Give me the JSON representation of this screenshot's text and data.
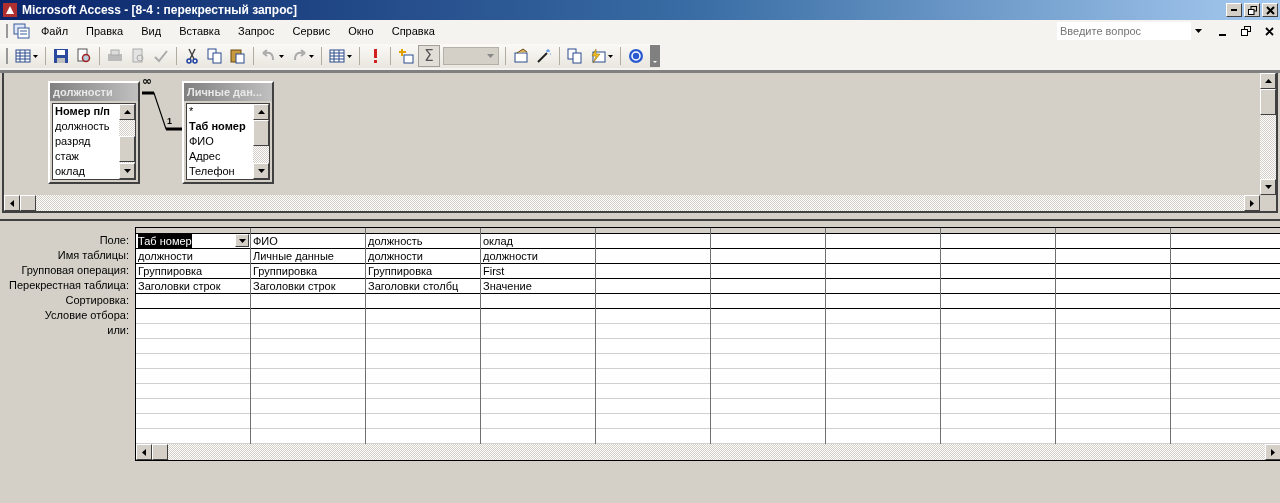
{
  "window": {
    "title": "Microsoft Access - [8-4 : перекрестный запрос]"
  },
  "menu": [
    "Файл",
    "Правка",
    "Вид",
    "Вставка",
    "Запрос",
    "Сервис",
    "Окно",
    "Справка"
  ],
  "help_search": {
    "placeholder": "Введите вопрос"
  },
  "toolbar": {
    "totals": {
      "label": "Σ",
      "on": true
    }
  },
  "tables": [
    {
      "name": "должности",
      "fields": [
        {
          "name": "Номер п/п",
          "key": true
        },
        {
          "name": "должность",
          "key": false
        },
        {
          "name": "разряд",
          "key": false
        },
        {
          "name": "стаж",
          "key": false
        },
        {
          "name": "оклад",
          "key": false
        }
      ]
    },
    {
      "name": "Личные дан...",
      "fields": [
        {
          "name": "*",
          "key": false
        },
        {
          "name": "Таб номер",
          "key": true
        },
        {
          "name": "ФИО",
          "key": false
        },
        {
          "name": "Адрес",
          "key": false
        },
        {
          "name": "Телефон",
          "key": false
        }
      ]
    }
  ],
  "relationship": {
    "many_label": "∞",
    "one_label": "1"
  },
  "grid": {
    "row_labels": [
      "Поле:",
      "Имя таблицы:",
      "Групповая операция:",
      "Перекрестная таблица:",
      "Сортировка:",
      "Условие отбора:",
      "или:"
    ],
    "columns": [
      {
        "selected": true,
        "cells": [
          "Таб номер",
          "должности",
          "Группировка",
          "Заголовки строк"
        ]
      },
      {
        "selected": false,
        "cells": [
          "ФИО",
          "Личные данные",
          "Группировка",
          "Заголовки строк"
        ]
      },
      {
        "selected": false,
        "cells": [
          "должность",
          "должности",
          "Группировка",
          "Заголовки столбц"
        ]
      },
      {
        "selected": false,
        "cells": [
          "оклад",
          "должности",
          "First",
          "Значение"
        ]
      }
    ]
  }
}
